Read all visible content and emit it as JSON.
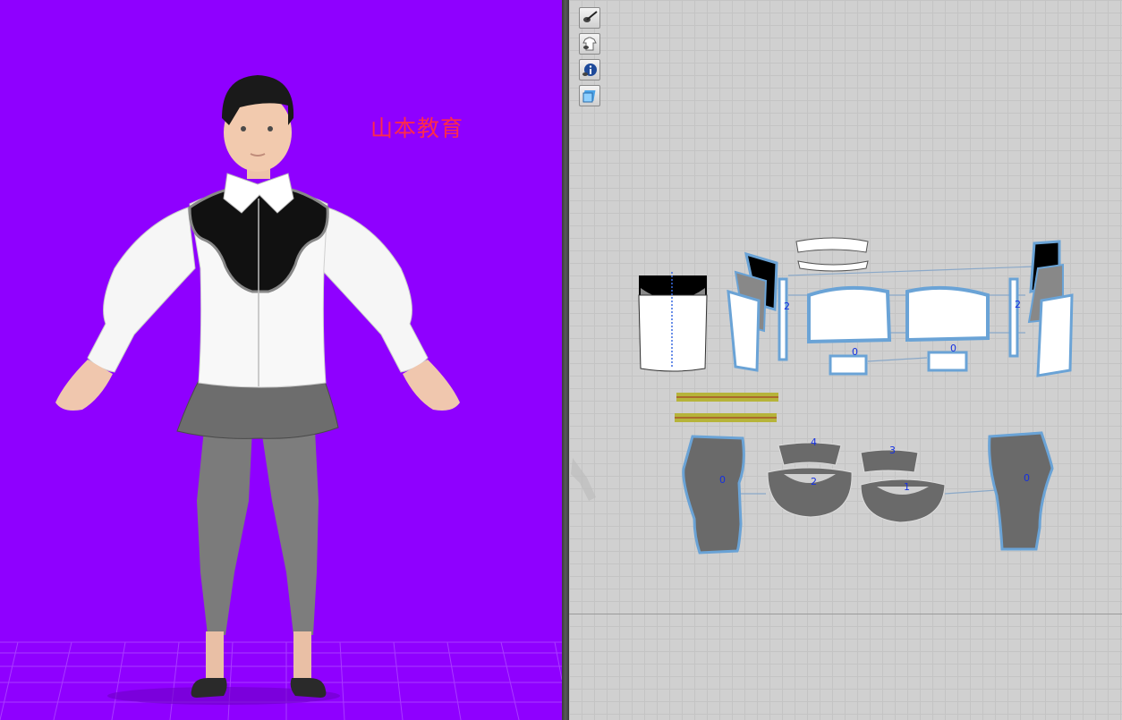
{
  "viewport_3d": {
    "watermark": "山本教育",
    "background_color": "#8f00ff",
    "grid_color": "#b04aff"
  },
  "viewport_2d": {
    "toolbar": [
      {
        "icon": "brush-visibility-icon"
      },
      {
        "icon": "garment-visibility-icon"
      },
      {
        "icon": "info-icon"
      },
      {
        "icon": "texture-icon"
      }
    ],
    "piece_labels": {
      "sleeve_left": "2",
      "sleeve_right": "2",
      "cuff_left": "0",
      "cuff_right": "0",
      "pants_left": "0",
      "pants_right": "0",
      "skirt_band_left": "4",
      "skirt_left": "2",
      "skirt_band_right": "3",
      "skirt_right": "1"
    },
    "colors": {
      "piece_white": "#ffffff",
      "piece_gray": "#6a6a6a",
      "piece_black": "#000000",
      "outline_blue": "#6aa3d6",
      "band_green": "#b6b43a",
      "label_blue": "#1530e0"
    }
  }
}
